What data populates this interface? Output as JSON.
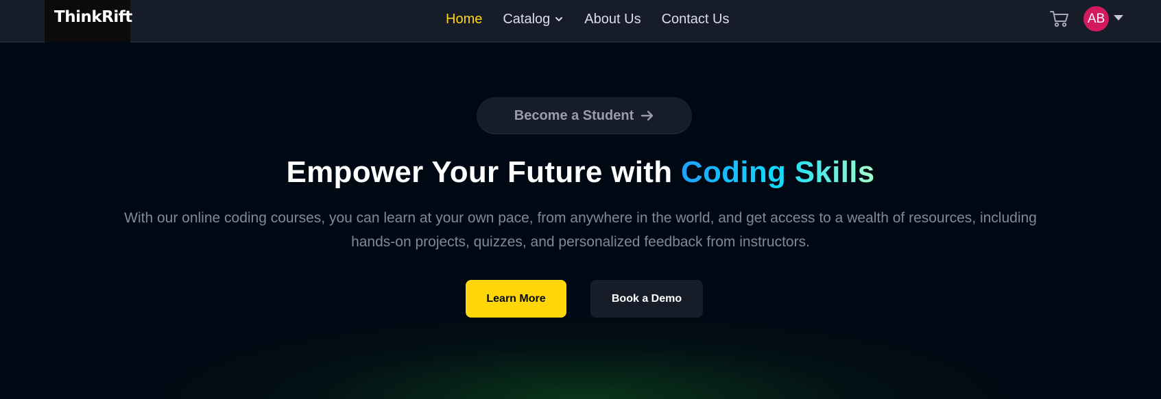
{
  "brand": {
    "logo_text": "ThinkRift"
  },
  "nav": {
    "items": [
      {
        "label": "Home",
        "active": true
      },
      {
        "label": "Catalog",
        "has_dropdown": true
      },
      {
        "label": "About Us"
      },
      {
        "label": "Contact Us"
      }
    ],
    "cart_icon": "cart-icon",
    "user": {
      "initials": "AB",
      "avatar_color": "#d31a5d",
      "dropdown_icon": "caret-down-icon"
    }
  },
  "hero": {
    "badge_label": "Become a Student",
    "badge_icon": "arrow-right-icon",
    "headline_prefix": "Empower Your Future with ",
    "headline_highlight": "Coding Skills",
    "description": "With our online coding courses, you can learn at your own pace, from anywhere in the world, and get access to a wealth of resources, including hands-on projects, quizzes, and personalized feedback from instructors.",
    "primary_button": "Learn More",
    "secondary_button": "Book a Demo"
  },
  "colors": {
    "accent": "#ffd60a",
    "background": "#000814",
    "navbar": "#161d29",
    "highlight_gradient": [
      "#1fa2ff",
      "#12d8fa",
      "#a6ffcb"
    ]
  }
}
